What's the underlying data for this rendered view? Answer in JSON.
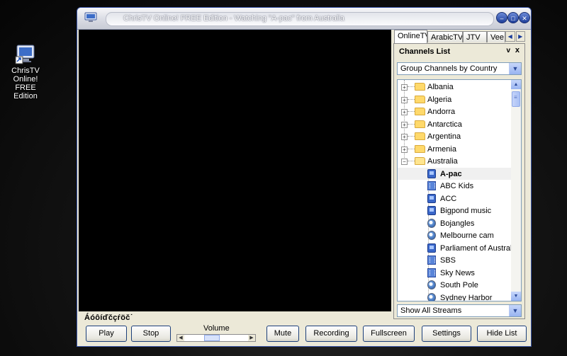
{
  "desktop": {
    "icon_label": "ChrisTV\nOnline! FREE\nEdition"
  },
  "window": {
    "title": "ChrisTV Online! FREE Edition - Watching \"A-pac\" from Australia",
    "minimize": "–",
    "maximize": "□",
    "close": "✕"
  },
  "status": {
    "text": "Áóôíďčçŕöč˙"
  },
  "tabs": [
    {
      "label": "OnlineTV",
      "active": true
    },
    {
      "label": "ArabicTV",
      "active": false
    },
    {
      "label": "JTV",
      "active": false
    },
    {
      "label": "Vee",
      "active": false
    }
  ],
  "channels_panel": {
    "title": "Channels List",
    "pin": "v",
    "close": "x",
    "group_by": "Group Channels by Country",
    "filter": "Show All Streams"
  },
  "tree": {
    "countries": [
      "Albania",
      "Algeria",
      "Andorra",
      "Antarctica",
      "Argentina",
      "Armenia",
      "Australia"
    ],
    "expanded_country": "Australia",
    "channels": [
      {
        "name": "A-pac",
        "icon": "tv-icon",
        "selected": true
      },
      {
        "name": "ABC Kids",
        "icon": "film-icon",
        "selected": false
      },
      {
        "name": "ACC",
        "icon": "tv-icon",
        "selected": false
      },
      {
        "name": "Bigpond music",
        "icon": "tv-icon",
        "selected": false
      },
      {
        "name": "Bojangles",
        "icon": "webcam-icon",
        "selected": false
      },
      {
        "name": "Melbourne cam",
        "icon": "webcam-icon",
        "selected": false
      },
      {
        "name": "Parliament of Australia",
        "icon": "tv-icon",
        "selected": false
      },
      {
        "name": "SBS",
        "icon": "film-icon",
        "selected": false
      },
      {
        "name": "Sky News",
        "icon": "film-icon",
        "selected": false
      },
      {
        "name": "South Pole",
        "icon": "webcam-icon",
        "selected": false
      },
      {
        "name": "Sydney Harbor",
        "icon": "webcam-icon",
        "selected": false
      }
    ]
  },
  "toolbar": {
    "play": "Play",
    "stop": "Stop",
    "volume_label": "Volume",
    "volume_level": 0.4,
    "mute": "Mute",
    "recording": "Recording",
    "fullscreen": "Fullscreen",
    "settings": "Settings",
    "hide_list": "Hide List"
  }
}
